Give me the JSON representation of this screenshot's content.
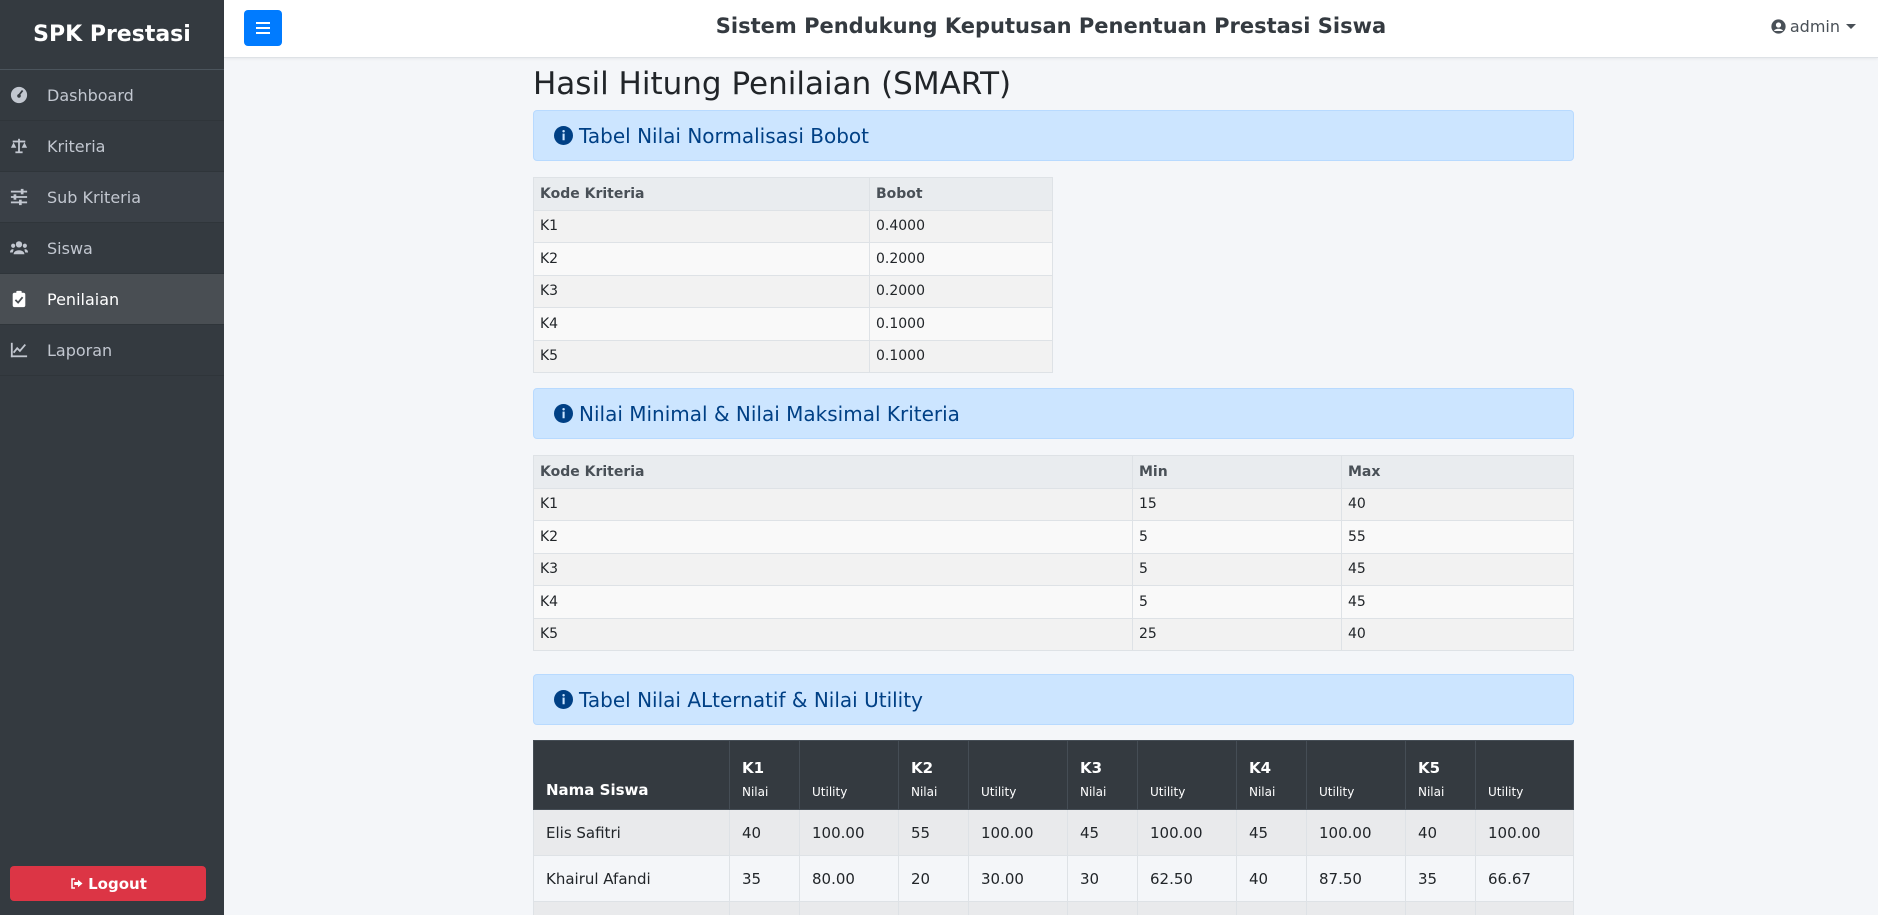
{
  "sidebar": {
    "brand": "SPK Prestasi",
    "items": [
      {
        "label": "Dashboard"
      },
      {
        "label": "Kriteria"
      },
      {
        "label": "Sub Kriteria"
      },
      {
        "label": "Siswa"
      },
      {
        "label": "Penilaian"
      },
      {
        "label": "Laporan"
      }
    ],
    "logout": "Logout"
  },
  "header": {
    "title": "Sistem Pendukung Keputusan Penentuan Prestasi Siswa",
    "user": "admin"
  },
  "page": {
    "title": "Hasil Hitung Penilaian (SMART)"
  },
  "section1": {
    "title": "Tabel Nilai Normalisasi Bobot",
    "headers": [
      "Kode Kriteria",
      "Bobot"
    ],
    "rows": [
      [
        "K1",
        "0.4000"
      ],
      [
        "K2",
        "0.2000"
      ],
      [
        "K3",
        "0.2000"
      ],
      [
        "K4",
        "0.1000"
      ],
      [
        "K5",
        "0.1000"
      ]
    ]
  },
  "section2": {
    "title": "Nilai Minimal & Nilai Maksimal Kriteria",
    "headers": [
      "Kode Kriteria",
      "Min",
      "Max"
    ],
    "rows": [
      [
        "K1",
        "15",
        "40"
      ],
      [
        "K2",
        "5",
        "55"
      ],
      [
        "K3",
        "5",
        "45"
      ],
      [
        "K4",
        "5",
        "45"
      ],
      [
        "K5",
        "25",
        "40"
      ]
    ]
  },
  "section3": {
    "title": "Tabel Nilai ALternatif & Nilai Utility",
    "name_header": "Nama Siswa",
    "criteria": [
      "K1",
      "K2",
      "K3",
      "K4",
      "K5"
    ],
    "nilai_label": "Nilai",
    "utility_label": "Utility",
    "rows": [
      [
        "Elis Safitri",
        "40",
        "100.00",
        "55",
        "100.00",
        "45",
        "100.00",
        "45",
        "100.00",
        "40",
        "100.00"
      ],
      [
        "Khairul Afandi",
        "35",
        "80.00",
        "20",
        "30.00",
        "30",
        "62.50",
        "40",
        "87.50",
        "35",
        "66.67"
      ],
      [
        "",
        "",
        "",
        "",
        "",
        "",
        "",
        "",
        "",
        "",
        ""
      ]
    ]
  },
  "colors": {
    "sidebar_bg": "#343a40",
    "primary": "#007bff",
    "danger": "#dc3545",
    "info_bg": "#cce5ff",
    "info_text": "#004085"
  },
  "icons": {
    "dashboard": "tachometer-icon",
    "kriteria": "balance-scale-icon",
    "sub_kriteria": "sliders-icon",
    "siswa": "users-icon",
    "penilaian": "clipboard-check-icon",
    "laporan": "chart-line-icon",
    "logout": "sign-out-icon",
    "menu": "bars-icon",
    "user": "user-circle-icon",
    "info": "info-circle-icon"
  }
}
